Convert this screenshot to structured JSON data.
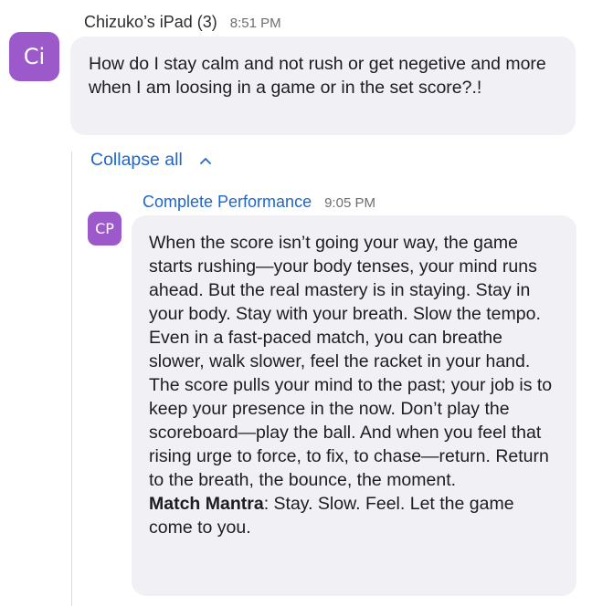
{
  "user_message": {
    "avatar_initials": "Ci",
    "sender": "Chizuko’s iPad (3)",
    "time": "8:51 PM",
    "text": "How do I stay calm and not rush or get negetive and more when I am loosing in a game or in the set score?.!"
  },
  "thread": {
    "collapse_label": "Collapse all",
    "collapse_icon": "chevron-up-icon"
  },
  "bot_message": {
    "avatar_initials": "CP",
    "sender": "Complete Performance",
    "time": "9:05 PM",
    "body": "When the score isn’t going your way, the game starts rushing—your body tenses, your mind runs ahead. But the real mastery is in staying. Stay in your body. Stay with your breath. Slow the tempo. Even in a fast-paced match, you can breathe slower, walk slower, feel the racket in your hand. The score pulls your mind to the past; your job is to keep your presence in the now. Don’t play the scoreboard—play the ball. And when you feel that rising urge to force, to fix, to chase—return. Return to the breath, the bounce, the moment.",
    "mantra_label": "Match Mantra",
    "mantra_text": ": Stay. Slow. Feel. Let the game come to you."
  },
  "colors": {
    "avatar_bg": "#9b59c9",
    "bubble_bg": "#f1f1f5",
    "link_blue": "#1f66c9"
  }
}
